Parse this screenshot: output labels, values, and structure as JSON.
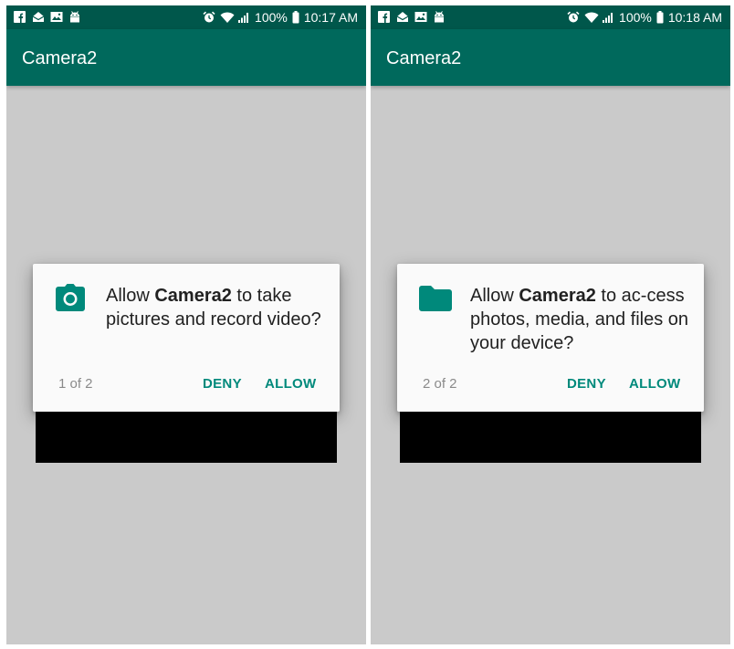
{
  "colors": {
    "status_bar": "#00574b",
    "app_bar": "#00695c",
    "accent": "#00897b",
    "background": "#cacaca"
  },
  "screens": [
    {
      "status_bar": {
        "left_icons": [
          "facebook-icon",
          "mail-icon",
          "image-icon",
          "android-icon"
        ],
        "battery": "100%",
        "time": "10:17 AM"
      },
      "app_bar": {
        "title": "Camera2"
      },
      "dialog": {
        "icon": "camera-icon",
        "message_pre": "Allow ",
        "app_name": "Camera2",
        "message_post": " to take pictures and record video?",
        "counter": "1 of 2",
        "deny_label": "DENY",
        "allow_label": "ALLOW"
      }
    },
    {
      "status_bar": {
        "left_icons": [
          "facebook-icon",
          "mail-icon",
          "image-icon",
          "android-icon"
        ],
        "battery": "100%",
        "time": "10:18 AM"
      },
      "app_bar": {
        "title": "Camera2"
      },
      "dialog": {
        "icon": "folder-icon",
        "message_pre": "Allow ",
        "app_name": "Camera2",
        "message_post": " to ac-cess photos, media, and files on your device?",
        "counter": "2 of 2",
        "deny_label": "DENY",
        "allow_label": "ALLOW"
      }
    }
  ]
}
